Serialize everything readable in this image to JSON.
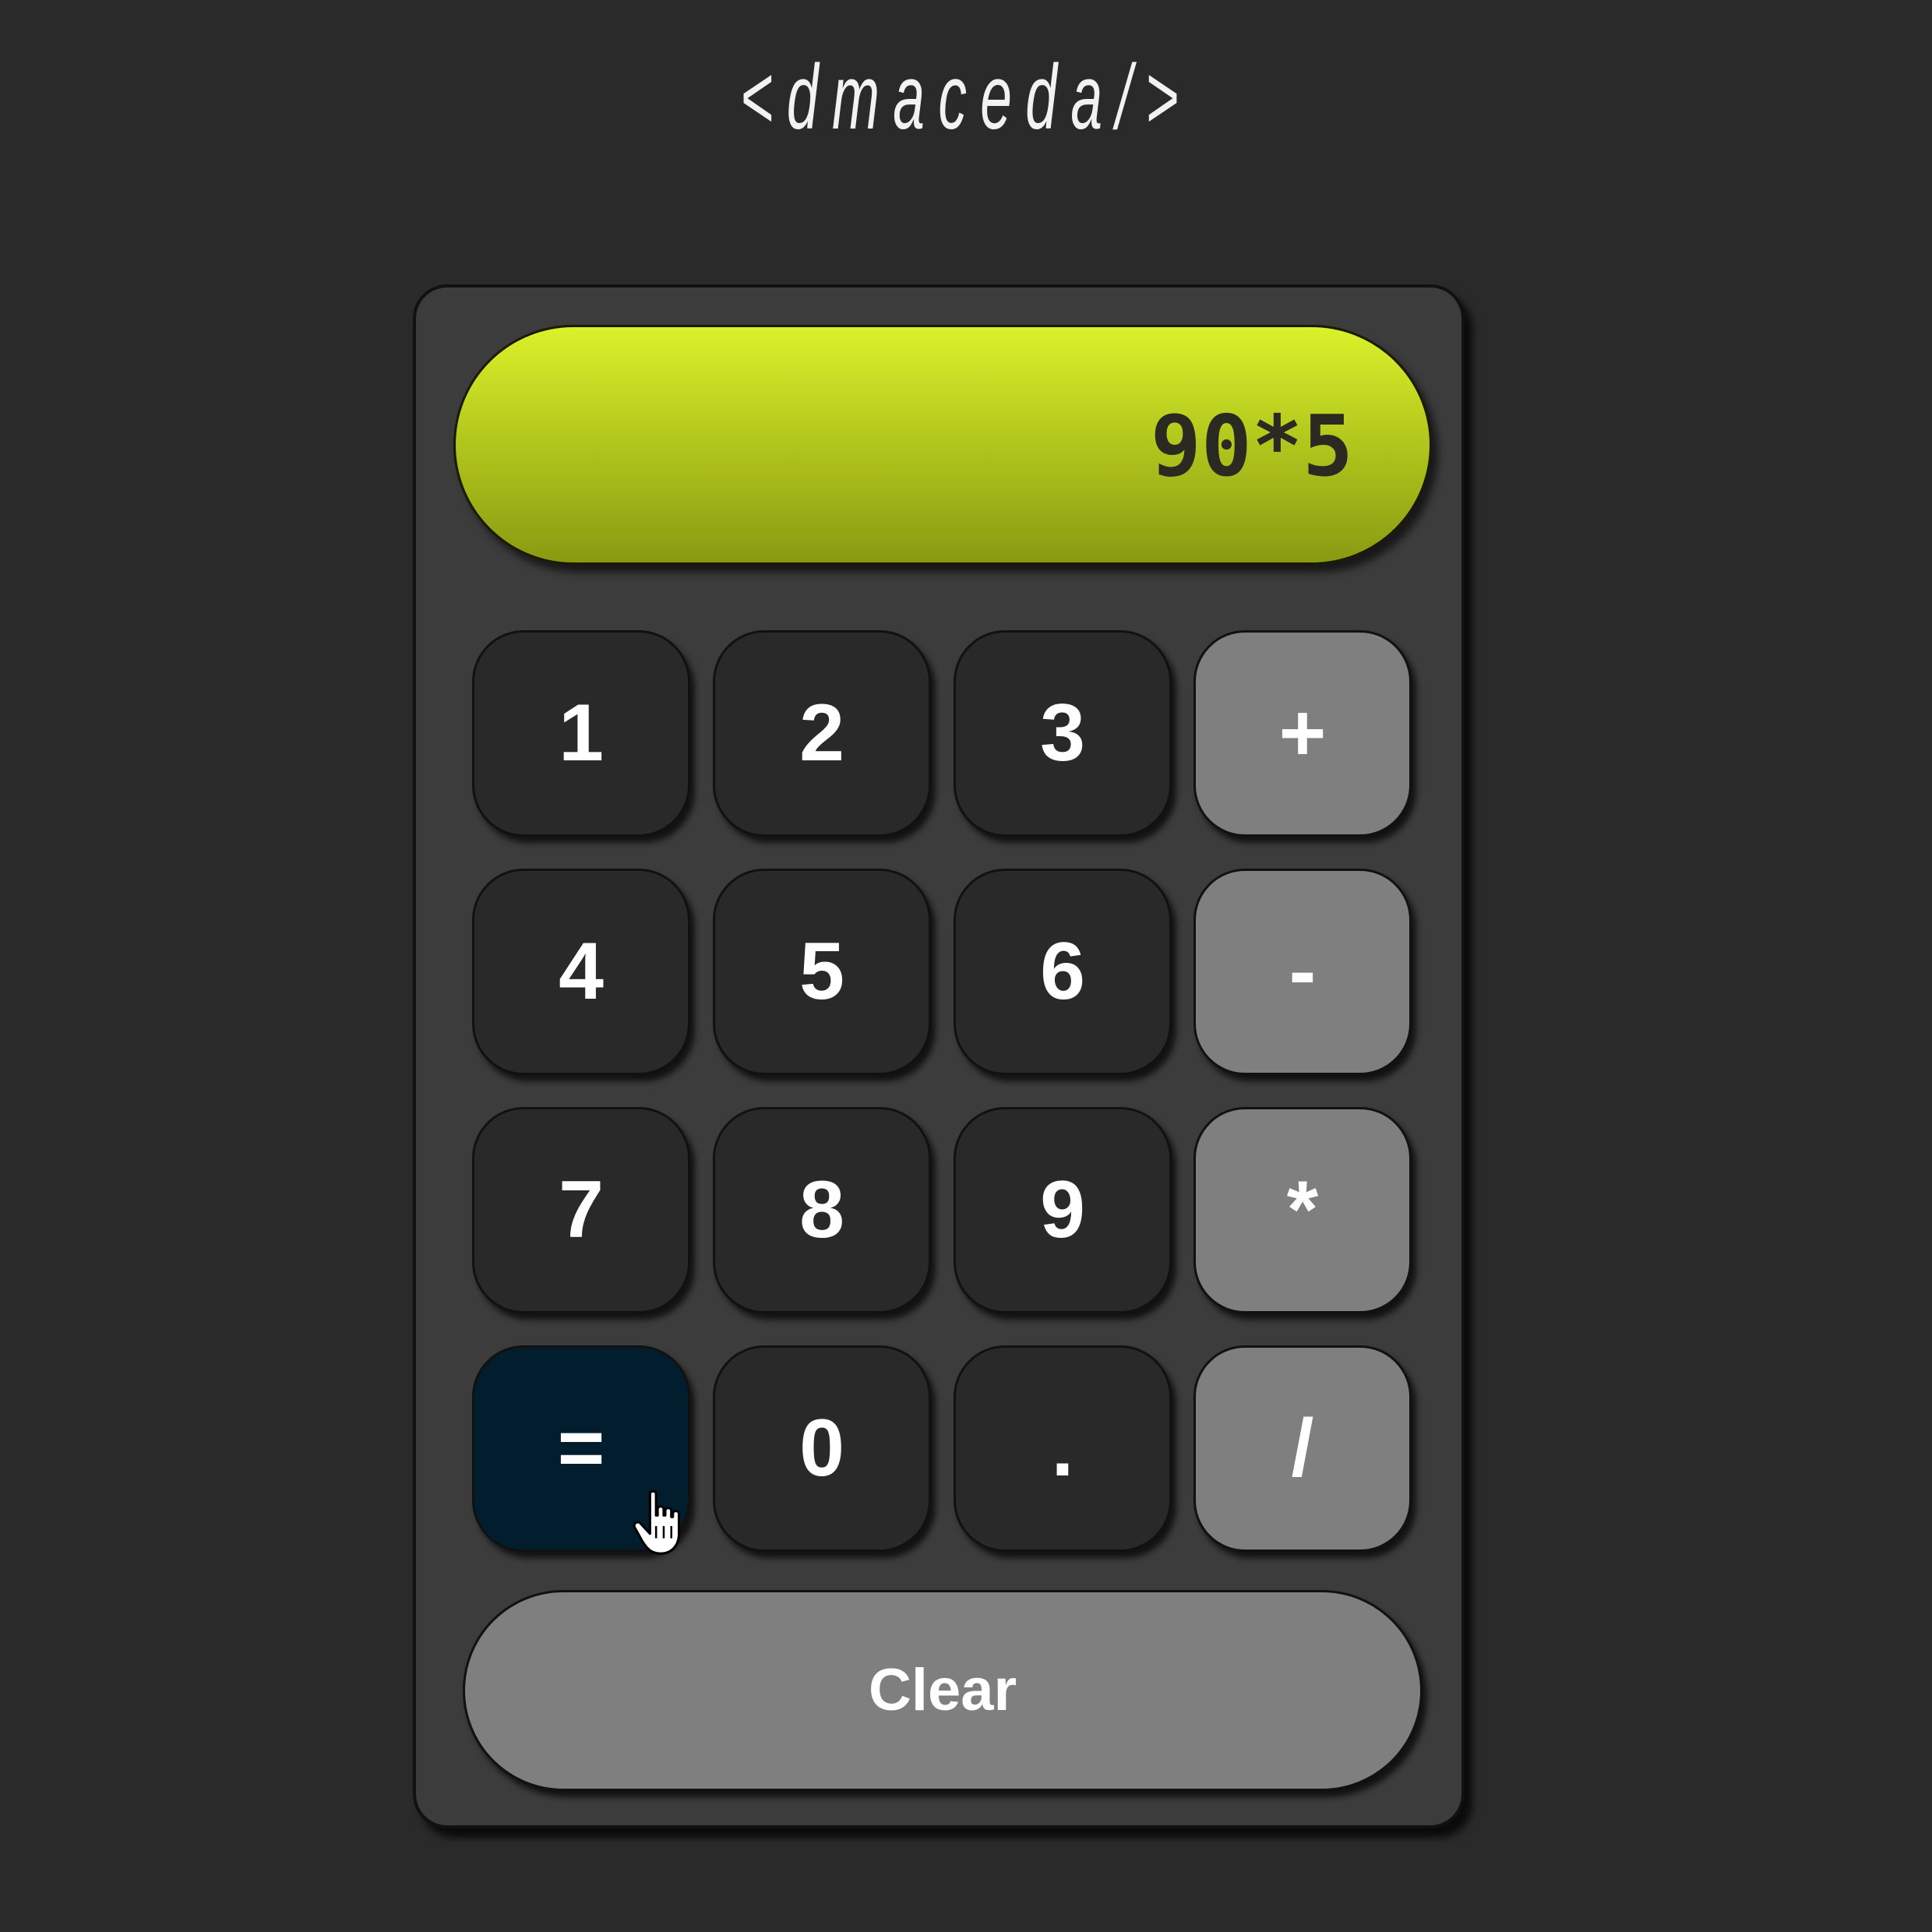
{
  "brand": {
    "text": "<dmaceda/>"
  },
  "display": {
    "value": "90*5"
  },
  "keys": {
    "k1": "1",
    "k2": "2",
    "k3": "3",
    "plus": "+",
    "k4": "4",
    "k5": "5",
    "k6": "6",
    "minus": "-",
    "k7": "7",
    "k8": "8",
    "k9": "9",
    "multiply": "*",
    "equals": "=",
    "k0": "0",
    "dot": ".",
    "divide": "/"
  },
  "clear_label": "Clear",
  "colors": {
    "background": "#2a2a2a",
    "calculator_body": "#3c3c3c",
    "display_top": "#dbf12a",
    "display_bottom": "#8a9a12",
    "digit_key": "#292929",
    "operator_key": "#7f7f7f",
    "equals_key": "#021e2e"
  },
  "icons": {
    "cursor": "hand-pointer-icon"
  }
}
